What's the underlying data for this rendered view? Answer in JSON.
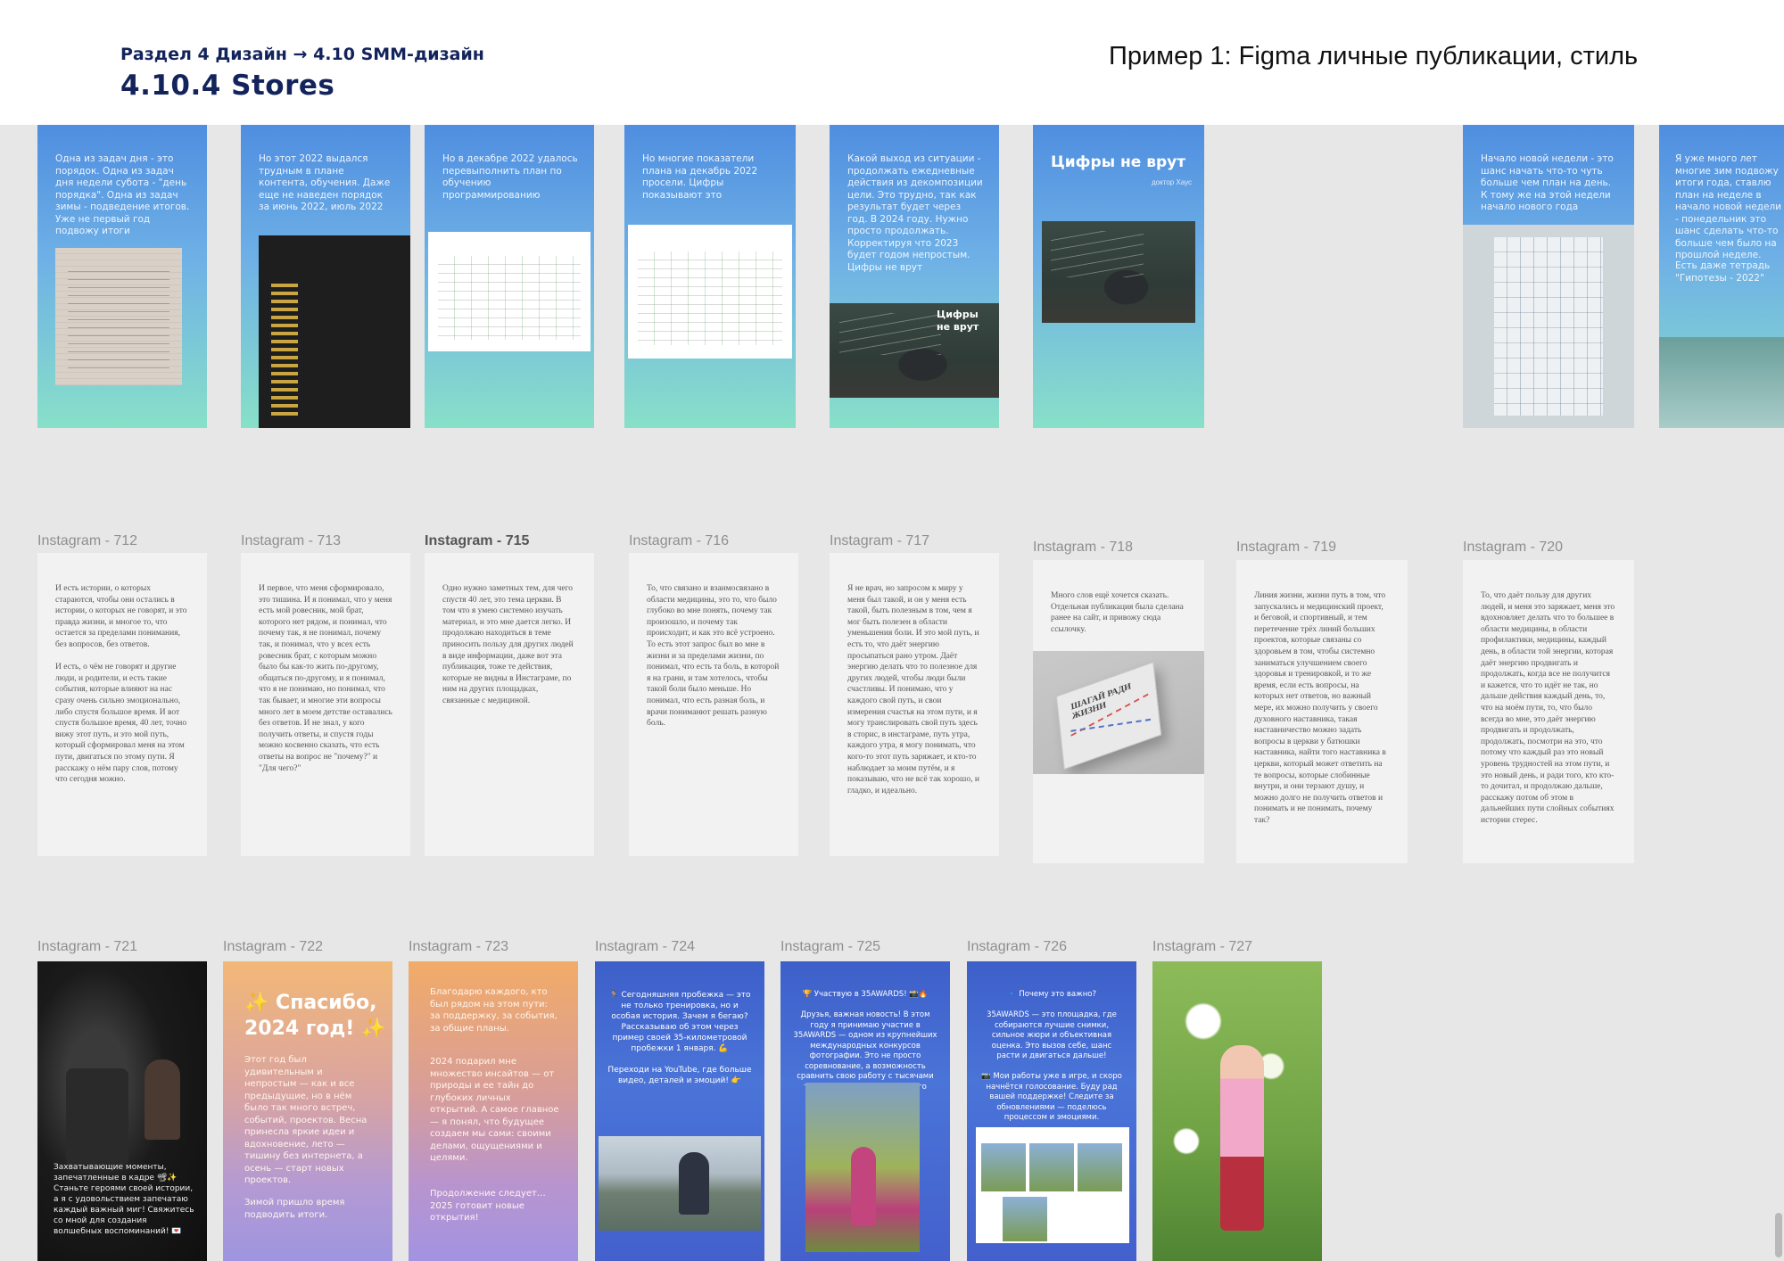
{
  "header": {
    "breadcrumb": "Раздел 4 Дизайн  → 4.10 SMM-дизайн",
    "title": "4.10.4 Stores",
    "caption": "Пример 1: Figma личные публикации, стиль"
  },
  "row1": {
    "f1": "Одна из задач дня - это порядок. Одна из задач дня недели субота - \"день порядка\". Одна из задач зимы - подведение итогов. Уже не первый год подвожу итоги",
    "f2": "Но этот 2022 выдался трудным в плане контента, обучения. Даже еще не наведен порядок за июнь 2022, июль 2022",
    "f3": "Но в декабре 2022 удалось перевыполнить план по обучению программированию",
    "f4": "Но многие показатели плана на декабрь 2022 просели. Цифры показывают это",
    "f5": "Какой выход из ситуации - продолжать ежедневные действия из декомпозиции цели. Это трудно, так как результат будет через год. В 2024 году. Нужно просто продолжать. Корректируя что 2023 будет годом непростым. Цифры не врут",
    "f5_overlay": "Цифры не врут",
    "f6_title": "Цифры не врут",
    "f6_sign": "доктор Хаус",
    "f7": "Начало новой недели - это шанс начать что-то чуть больше чем план на день. К тому же на этой недели начало нового года",
    "f8": "Я уже много лет многие зим подвожу итоги года, ставлю план на неделе в начало новой недели - понедельник это шанс сделать что-то больше чем было на прошлой неделе.",
    "f8_extra": "Есть даже тетрадь \"Гипотезы - 2022\""
  },
  "row2": {
    "labels": [
      "Instagram - 712",
      "Instagram - 713",
      "Instagram - 715",
      "Instagram - 716",
      "Instagram - 717",
      "Instagram - 718",
      "Instagram - 719",
      "Instagram - 720"
    ],
    "t712": "И есть истории, о которых стараются, чтобы они остались в истории, о которых не говорят, и это правда жизни, и многое то, что остается за пределами понимания, без вопросов, без ответов.\n\nИ есть, о чём не говорят и другие люди, и родители, и есть такие события, которые влияют на нас сразу очень сильно эмоционально, либо спустя большое время. И вот спустя большое время, 40 лет, точно вижу этот путь, и это мой путь, который сформировал меня на этом пути, двигаться по этому пути. Я расскажу о нём пару слов, потому что сегодня можно.",
    "t713": "И первое, что меня сформировало, это тишина. И я понимал, что у меня есть мой ровесник, мой брат, которого нет рядом, и понимал, что почему так, я не понимал, почему так, и понимал, что у всех есть ровесник брат, с которым можно было бы как-то жить по-другому, общаться по-другому, и я понимал, что я не понимаю, но понимал, что так бывает, и многие эти вопросы много лет в моем детстве оставались без ответов. И не знал, у кого получить ответы, и спустя годы можно косвенно сказать, что есть ответы на вопрос не \"почему?\" и \"Для чего?\"",
    "t715": "Одно нужно заметных тем, для чего спустя 40 лет, это тема церкви. В том что я умею системно изучать материал, и это мне дается легко. И продолжаю находиться в теме приносить пользу для других людей в виде информации, даже вот эта публикация, тоже те действия, которые не видны в Инстаграме, по ним на других площадках, связанные с медициной.",
    "t716": "То, что связано и взаимосвязано в области медицины, это то, что было глубоко во мне понять, почему так произошло, и почему так происходит, и как это всё устроено. То есть этот запрос был во мне в жизни и за пределами жизни, по понимал, что есть та боль, в которой я на грани, и там хотелось, чтобы такой боли было меньше. Но понимал, что есть разная боль, и врачи пониманют решать разную боль.",
    "t717": "Я не врач, но запросом к миру у меня был такой, и он у меня есть такой, быть полезным в том, чем я мог быть полезен в области уменьшения боли. И это мой путь, и есть то, что даёт энергию просыпаться рано утром. Даёт энергию делать что то полезное для других людей, чтобы люди были счастливы. И понимаю, что у каждого свой путь, и свои измерения счастья на этом пути, и я могу транслировать свой путь здесь в сторис, в инстаграме, путь утра, каждого утра, я могу понимать, что кого-то этот путь заряжает, и кто-то наблюдает за моим путём, и я показываю, что не всё так хорошо, и гладко, и идеально.",
    "t718": "Много слов ещё хочется сказать. Отдельная публикация была сделана ранее на сайт, и привожу сюда ссылочку.",
    "book_title": "ШАГАЙ РАДИ ЖИЗНИ",
    "t719": "Линия жизни, жизни путь в том, что запускались и медицинский проект, и беговой, и спортивный, и тем перетечение трёх линий больших проектов, которые связаны со здоровьем в том, чтобы системно заниматься улучшением своего здоровья и тренировкой, и то же время, если есть вопросы, на которых нет ответов, но важный мере, их можно получить у своего духовного наставника, такая наставничество можно задать вопросы в церкви у батюшки наставника, найти того наставника в церкви, который может ответить на те вопросы, которые слобинные внутри, и они терзают душу, и можно долго не получить ответов и понимать и не понимать, почему так?",
    "t720": "То, что даёт пользу для других людей, и меня это заряжает, меня это вдохновляет делать что то большее в области медицины, в области профилактики, медицины, каждый день, в области той энергии, которая даёт энергию продвигать и продолжать, когда все не получится и кажется, что то идёт не так, но дальше действия каждый день, то, что на моём пути, то, что было всегда во мне, это даёт энергию продвигать и продолжать, продолжать, посмотри на это, что потому что каждый раз это новый уровень трудностей на этом пути, и это новый день, и ради того, кто кто-то дочитал, и продолжаю дальше, расскажу потом об этом в дальнейших пути слойных событиях истории стерес."
  },
  "row3": {
    "labels": [
      "Instagram - 721",
      "Instagram - 722",
      "Instagram - 723",
      "Instagram - 724",
      "Instagram - 725",
      "Instagram - 726",
      "Instagram - 727"
    ],
    "s721": "Захватывающие моменты, запечатленные в кадре 📽✨ Станьте героями своей истории, а я с удовольствием запечатаю каждый важный миг! Свяжитесь со мной для создания волшебных воспоминаний! 💌",
    "s722_title": "✨ Спасибо, 2024 год! ✨",
    "s722_body": "Этот год был удивительным и непростым — как и все предыдущие, но в нём было так много встреч, событий, проектов. Весна принесла яркие идеи и вдохновение, лето — тишину без интернета, а осень — старт новых проектов.",
    "s722_footer": "Зимой пришло время подводить итоги.",
    "s723_p1": "Благодарю каждого, кто был рядом на этом пути: за поддержку, за события, за общие планы.",
    "s723_p2": "2024 подарил мне множество инсайтов — от природы и ее тайн до глубоких личных открытий. А самое главное — я понял, что будущее создаем мы сами: своими делами, ощущениями и целями.",
    "s723_p3": "Продолжение следует… 2025 готовит новые открытия!",
    "s724": "🏃 Сегодняшняя пробежка — это не только тренировка, но и особая история. Зачем я бегаю? Рассказываю об этом через пример своей 35-километровой пробежки 1 января. 💪\n\nПереходи на YouTube, где больше видео, деталей и эмоций! 👉",
    "s725": "🏆 Участвую в 35AWARDS! 📸🔥\n\nДрузья, важная новость! В этом году я принимаю участие в 35AWARDS — одном из крупнейших международных конкурсов фотографии. Это не просто соревнование, а возможность сравнить свою работу с тысячами талантливых авторов со всего мира!",
    "s726": "🔹 Почему это важно?\n\n35AWARDS — это площадка, где собираются лучшие снимки, сильное жюри и объективная оценка. Это вызов себе, шанс расти и двигаться дальше!\n\n📷 Мои работы уже в игре, и скоро начнётся голосование. Буду рад вашей поддержке! Следите за обновлениями — поделюсь процессом и эмоциями."
  }
}
